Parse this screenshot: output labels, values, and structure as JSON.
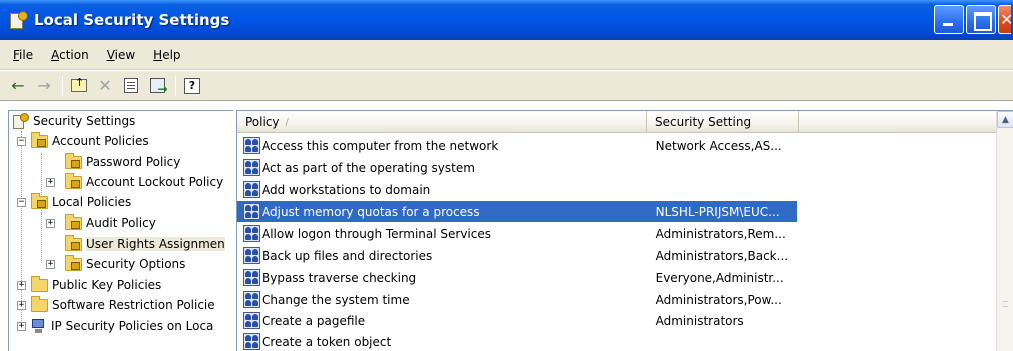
{
  "window": {
    "title": "Local Security Settings",
    "icon": "security-settings-icon"
  },
  "menu": [
    {
      "label": "File",
      "accel": "F",
      "rest": "ile"
    },
    {
      "label": "Action",
      "accel": "A",
      "rest": "ction"
    },
    {
      "label": "View",
      "accel": "V",
      "rest": "iew"
    },
    {
      "label": "Help",
      "accel": "H",
      "rest": "elp"
    }
  ],
  "toolbar": {
    "back": "←",
    "forward": "→",
    "delete": "✕"
  },
  "tree": {
    "root": "Security Settings",
    "account_policies": "Account Policies",
    "password_policy": "Password Policy",
    "lockout_policy": "Account Lockout Policy",
    "local_policies": "Local Policies",
    "audit_policy": "Audit Policy",
    "user_rights": "User Rights Assignmen",
    "security_options": "Security Options",
    "public_key": "Public Key Policies",
    "software_restriction": "Software Restriction Policie",
    "ipsec": "IP Security Policies on Loca"
  },
  "list": {
    "col_policy": "Policy",
    "col_setting": "Security Setting",
    "rows": [
      {
        "policy": "Access this computer from the network",
        "setting": "Network Access,AS..."
      },
      {
        "policy": "Act as part of the operating system",
        "setting": ""
      },
      {
        "policy": "Add workstations to domain",
        "setting": ""
      },
      {
        "policy": "Adjust memory quotas for a process",
        "setting": "NLSHL-PRIJSM\\EUC..."
      },
      {
        "policy": "Allow logon through Terminal Services",
        "setting": "Administrators,Rem..."
      },
      {
        "policy": "Back up files and directories",
        "setting": "Administrators,Back..."
      },
      {
        "policy": "Bypass traverse checking",
        "setting": "Everyone,Administr..."
      },
      {
        "policy": "Change the system time",
        "setting": "Administrators,Pow..."
      },
      {
        "policy": "Create a pagefile",
        "setting": "Administrators"
      },
      {
        "policy": "Create a token object",
        "setting": ""
      }
    ]
  },
  "colors": {
    "titlebar": "#0055e5",
    "selection": "#316ac5",
    "chrome": "#ece9d8"
  }
}
